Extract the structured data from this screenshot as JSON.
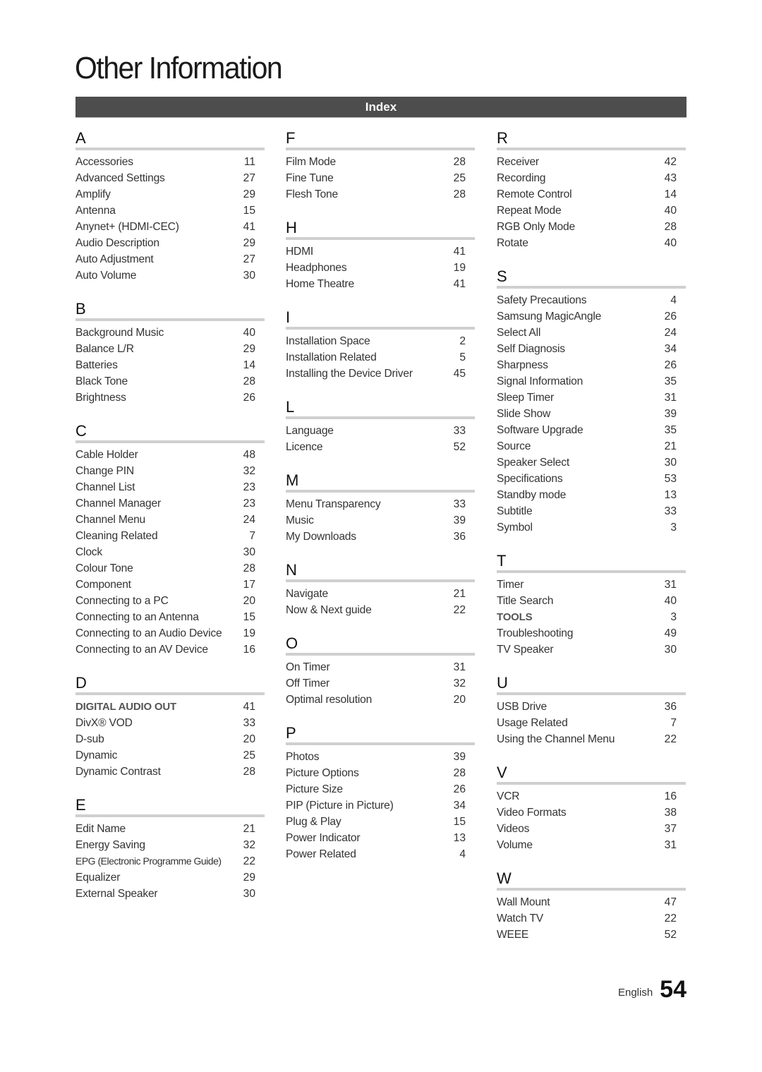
{
  "page_title": "Other Information",
  "section_header": "Index",
  "footer": {
    "language": "English",
    "page_number": "54"
  },
  "columns": [
    [
      {
        "letter": "A",
        "entries": [
          {
            "term": "Accessories",
            "page": "11"
          },
          {
            "term": "Advanced Settings",
            "page": "27"
          },
          {
            "term": "Amplify",
            "page": "29"
          },
          {
            "term": "Antenna",
            "page": "15"
          },
          {
            "term": "Anynet+ (HDMI-CEC)",
            "page": "41"
          },
          {
            "term": "Audio Description",
            "page": "29"
          },
          {
            "term": "Auto Adjustment",
            "page": "27"
          },
          {
            "term": "Auto Volume",
            "page": "30"
          }
        ]
      },
      {
        "letter": "B",
        "entries": [
          {
            "term": "Background Music",
            "page": "40"
          },
          {
            "term": "Balance L/R",
            "page": "29"
          },
          {
            "term": "Batteries",
            "page": "14"
          },
          {
            "term": "Black Tone",
            "page": "28"
          },
          {
            "term": "Brightness",
            "page": "26"
          }
        ]
      },
      {
        "letter": "C",
        "entries": [
          {
            "term": "Cable Holder",
            "page": "48"
          },
          {
            "term": "Change PIN",
            "page": "32"
          },
          {
            "term": "Channel List",
            "page": "23"
          },
          {
            "term": "Channel Manager",
            "page": "23"
          },
          {
            "term": "Channel Menu",
            "page": "24"
          },
          {
            "term": "Cleaning Related",
            "page": "7"
          },
          {
            "term": "Clock",
            "page": "30"
          },
          {
            "term": "Colour Tone",
            "page": "28"
          },
          {
            "term": "Component",
            "page": "17"
          },
          {
            "term": "Connecting to a PC",
            "page": "20"
          },
          {
            "term": "Connecting to an Antenna",
            "page": "15"
          },
          {
            "term": "Connecting to an Audio Device",
            "page": "19"
          },
          {
            "term": "Connecting to an AV Device",
            "page": "16"
          }
        ]
      },
      {
        "letter": "D",
        "entries": [
          {
            "term": "DIGITAL AUDIO OUT",
            "page": "41",
            "style": "caps"
          },
          {
            "term": "DivX® VOD",
            "page": "33"
          },
          {
            "term": "D-sub",
            "page": "20"
          },
          {
            "term": "Dynamic",
            "page": "25"
          },
          {
            "term": "Dynamic Contrast",
            "page": "28"
          }
        ]
      },
      {
        "letter": "E",
        "entries": [
          {
            "term": "Edit Name",
            "page": "21"
          },
          {
            "term": "Energy Saving",
            "page": "32"
          },
          {
            "term": "EPG (Electronic Programme Guide)",
            "page": "22",
            "style": "narrow"
          },
          {
            "term": "Equalizer",
            "page": "29"
          },
          {
            "term": "External Speaker",
            "page": "30"
          }
        ]
      }
    ],
    [
      {
        "letter": "F",
        "entries": [
          {
            "term": "Film Mode",
            "page": "28"
          },
          {
            "term": "Fine Tune",
            "page": "25"
          },
          {
            "term": "Flesh Tone",
            "page": "28"
          }
        ]
      },
      {
        "letter": "H",
        "entries": [
          {
            "term": "HDMI",
            "page": "41"
          },
          {
            "term": "Headphones",
            "page": "19"
          },
          {
            "term": "Home Theatre",
            "page": "41"
          }
        ]
      },
      {
        "letter": "I",
        "entries": [
          {
            "term": "Installation Space",
            "page": "2"
          },
          {
            "term": "Installation Related",
            "page": "5"
          },
          {
            "term": "Installing the Device Driver",
            "page": "45"
          }
        ]
      },
      {
        "letter": "L",
        "entries": [
          {
            "term": "Language",
            "page": "33"
          },
          {
            "term": "Licence",
            "page": "52"
          }
        ]
      },
      {
        "letter": "M",
        "entries": [
          {
            "term": "Menu Transparency",
            "page": "33"
          },
          {
            "term": "Music",
            "page": "39"
          },
          {
            "term": "My Downloads",
            "page": "36"
          }
        ]
      },
      {
        "letter": "N",
        "entries": [
          {
            "term": "Navigate",
            "page": "21"
          },
          {
            "term": "Now & Next guide",
            "page": "22"
          }
        ]
      },
      {
        "letter": "O",
        "entries": [
          {
            "term": "On Timer",
            "page": "31"
          },
          {
            "term": "Off Timer",
            "page": "32"
          },
          {
            "term": "Optimal resolution",
            "page": "20"
          }
        ]
      },
      {
        "letter": "P",
        "entries": [
          {
            "term": "Photos",
            "page": "39"
          },
          {
            "term": "Picture Options",
            "page": "28"
          },
          {
            "term": "Picture Size",
            "page": "26"
          },
          {
            "term": "PIP (Picture in Picture)",
            "page": "34"
          },
          {
            "term": "Plug & Play",
            "page": "15"
          },
          {
            "term": "Power Indicator",
            "page": "13"
          },
          {
            "term": "Power Related",
            "page": "4"
          }
        ]
      }
    ],
    [
      {
        "letter": "R",
        "entries": [
          {
            "term": "Receiver",
            "page": "42"
          },
          {
            "term": "Recording",
            "page": "43"
          },
          {
            "term": "Remote Control",
            "page": "14"
          },
          {
            "term": "Repeat Mode",
            "page": "40"
          },
          {
            "term": "RGB Only Mode",
            "page": "28"
          },
          {
            "term": "Rotate",
            "page": "40"
          }
        ]
      },
      {
        "letter": "S",
        "entries": [
          {
            "term": "Safety Precautions",
            "page": "4"
          },
          {
            "term": "Samsung MagicAngle",
            "page": "26"
          },
          {
            "term": "Select All",
            "page": "24"
          },
          {
            "term": "Self Diagnosis",
            "page": "34"
          },
          {
            "term": "Sharpness",
            "page": "26"
          },
          {
            "term": "Signal Information",
            "page": "35"
          },
          {
            "term": "Sleep Timer",
            "page": "31"
          },
          {
            "term": "Slide Show",
            "page": "39"
          },
          {
            "term": "Software Upgrade",
            "page": "35"
          },
          {
            "term": "Source",
            "page": "21"
          },
          {
            "term": "Speaker Select",
            "page": "30"
          },
          {
            "term": "Specifications",
            "page": "53"
          },
          {
            "term": "Standby mode",
            "page": "13"
          },
          {
            "term": "Subtitle",
            "page": "33"
          },
          {
            "term": "Symbol",
            "page": "3"
          }
        ]
      },
      {
        "letter": "T",
        "entries": [
          {
            "term": "Timer",
            "page": "31"
          },
          {
            "term": "Title Search",
            "page": "40"
          },
          {
            "term": "TOOLS",
            "page": "3",
            "style": "caps"
          },
          {
            "term": "Troubleshooting",
            "page": "49"
          },
          {
            "term": "TV Speaker",
            "page": "30"
          }
        ]
      },
      {
        "letter": "U",
        "entries": [
          {
            "term": "USB Drive",
            "page": "36"
          },
          {
            "term": "Usage Related",
            "page": "7"
          },
          {
            "term": "Using the Channel Menu",
            "page": "22"
          }
        ]
      },
      {
        "letter": "V",
        "entries": [
          {
            "term": "VCR",
            "page": "16"
          },
          {
            "term": "Video Formats",
            "page": "38"
          },
          {
            "term": "Videos",
            "page": "37"
          },
          {
            "term": "Volume",
            "page": "31"
          }
        ]
      },
      {
        "letter": "W",
        "entries": [
          {
            "term": "Wall Mount",
            "page": "47"
          },
          {
            "term": "Watch TV",
            "page": "22"
          },
          {
            "term": "WEEE",
            "page": "52"
          }
        ]
      }
    ]
  ]
}
